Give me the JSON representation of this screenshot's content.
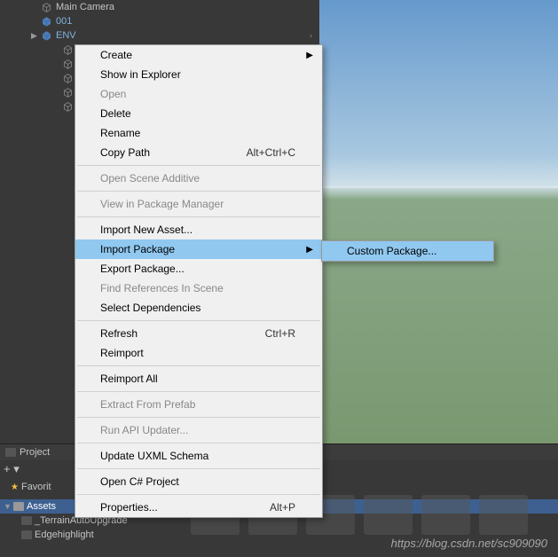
{
  "hierarchy": {
    "items": [
      {
        "label": "Main Camera",
        "prefab": false
      },
      {
        "label": "001",
        "prefab": true
      },
      {
        "label": "ENV",
        "prefab": true,
        "expand": true
      }
    ]
  },
  "context_menu": {
    "items": [
      {
        "label": "Create",
        "arrow": true,
        "disabled": false
      },
      {
        "label": "Show in Explorer",
        "disabled": false
      },
      {
        "label": "Open",
        "disabled": true
      },
      {
        "label": "Delete",
        "disabled": false
      },
      {
        "label": "Rename",
        "disabled": false
      },
      {
        "label": "Copy Path",
        "shortcut": "Alt+Ctrl+C",
        "disabled": false
      },
      {
        "sep": true
      },
      {
        "label": "Open Scene Additive",
        "disabled": true
      },
      {
        "sep": true
      },
      {
        "label": "View in Package Manager",
        "disabled": true
      },
      {
        "sep": true
      },
      {
        "label": "Import New Asset...",
        "disabled": false
      },
      {
        "label": "Import Package",
        "arrow": true,
        "highlighted": true,
        "disabled": false
      },
      {
        "label": "Export Package...",
        "disabled": false
      },
      {
        "label": "Find References In Scene",
        "disabled": true
      },
      {
        "label": "Select Dependencies",
        "disabled": false
      },
      {
        "sep": true
      },
      {
        "label": "Refresh",
        "shortcut": "Ctrl+R",
        "disabled": false
      },
      {
        "label": "Reimport",
        "disabled": false
      },
      {
        "sep": true
      },
      {
        "label": "Reimport All",
        "disabled": false
      },
      {
        "sep": true
      },
      {
        "label": "Extract From Prefab",
        "disabled": true
      },
      {
        "sep": true
      },
      {
        "label": "Run API Updater...",
        "disabled": true
      },
      {
        "sep": true
      },
      {
        "label": "Update UXML Schema",
        "disabled": false
      },
      {
        "sep": true
      },
      {
        "label": "Open C# Project",
        "disabled": false
      },
      {
        "sep": true
      },
      {
        "label": "Properties...",
        "shortcut": "Alt+P",
        "disabled": false
      }
    ]
  },
  "submenu": {
    "items": [
      {
        "label": "Custom Package...",
        "highlighted": true
      }
    ]
  },
  "project": {
    "tab_label": "Project",
    "toolbar_symbols": "+ ▾",
    "favorites_label": "Favorit",
    "assets_label": "Assets",
    "folders": [
      {
        "label": "_TerrainAutoUpgrade"
      },
      {
        "label": "Edgehighlight"
      }
    ]
  },
  "watermark": "https://blog.csdn.net/sc909090"
}
